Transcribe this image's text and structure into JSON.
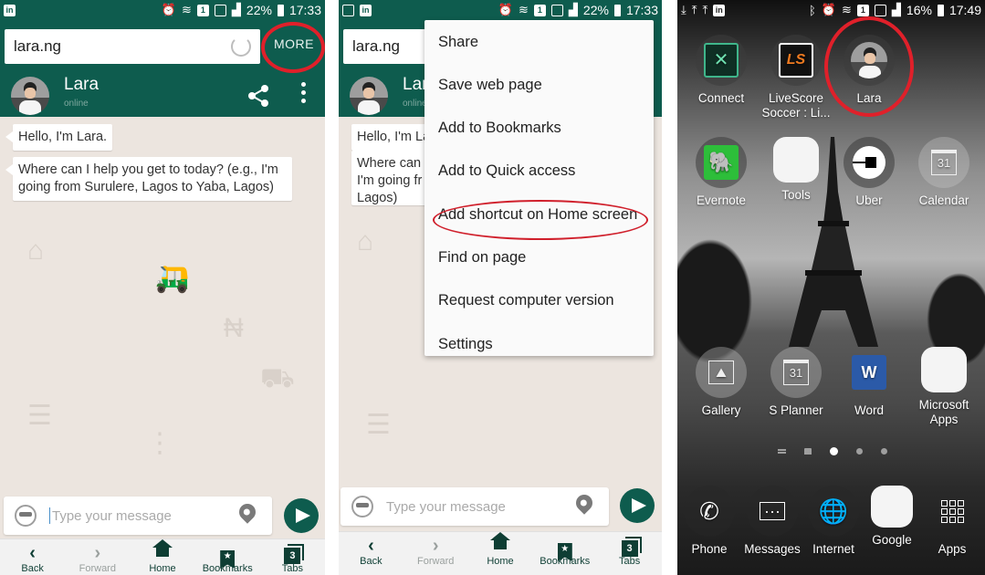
{
  "colors": {
    "brand_green": "#0e5c4e",
    "chat_background": "#ece5df",
    "annotation_red": "#d0202c"
  },
  "panel1": {
    "statusbar": {
      "left_icons": [
        "linkedin-icon"
      ],
      "right_icons": [
        "alarm-icon",
        "wifi-icon",
        "sim1-icon",
        "signal-icon",
        "signal-icon"
      ],
      "battery": "22%",
      "time": "17:33"
    },
    "url": "lara.ng",
    "more_label": "MORE",
    "contact": {
      "name": "Lara",
      "status": "online"
    },
    "messages": [
      {
        "text": "Hello, I'm Lara."
      },
      {
        "text": "Where can I help you get to today? (e.g., I'm going from Surulere, Lagos to Yaba, Lagos)"
      }
    ],
    "composer_placeholder": "Type your message",
    "nav": [
      {
        "label": "Back",
        "icon": "chevron-left-icon",
        "enabled": true
      },
      {
        "label": "Forward",
        "icon": "chevron-right-icon",
        "enabled": false
      },
      {
        "label": "Home",
        "icon": "home-icon",
        "enabled": true
      },
      {
        "label": "Bookmarks",
        "icon": "bookmark-star-icon",
        "enabled": true
      },
      {
        "label": "Tabs",
        "icon": "tabs-icon",
        "enabled": true,
        "count": "3"
      }
    ]
  },
  "panel2": {
    "statusbar": {
      "battery": "22%",
      "time": "17:33"
    },
    "url": "lara.ng",
    "contact": {
      "name": "Lara",
      "status": "online"
    },
    "messages_partial": [
      {
        "text": "Hello, I'm La"
      },
      {
        "text": "Where can I'm going fr Lagos)"
      }
    ],
    "menu": [
      {
        "label": "Share"
      },
      {
        "label": "Save web page"
      },
      {
        "label": "Add to Bookmarks"
      },
      {
        "label": "Add to Quick access"
      },
      {
        "label": "Add shortcut on Home screen",
        "highlighted": true
      },
      {
        "label": "Find on page"
      },
      {
        "label": "Request computer version"
      },
      {
        "label": "Settings"
      }
    ],
    "composer_placeholder": "Type your message",
    "nav": [
      {
        "label": "Back"
      },
      {
        "label": "Forward"
      },
      {
        "label": "Home"
      },
      {
        "label": "Bookmarks"
      },
      {
        "label": "Tabs",
        "count": "3"
      }
    ]
  },
  "panel3": {
    "statusbar": {
      "left_icons": [
        "download-icon",
        "upload-icon",
        "upload-icon",
        "linkedin-icon"
      ],
      "right_icons": [
        "bluetooth-icon",
        "alarm-icon",
        "wifi-icon",
        "sim1-icon",
        "signal-icon",
        "signal-icon"
      ],
      "battery": "16%",
      "time": "17:49"
    },
    "apps_row1": [
      {
        "label": "Connect",
        "icon": "connect-icon"
      },
      {
        "label": "LiveScore Soccer : Li...",
        "icon": "livescore-icon",
        "logo": "LS"
      },
      {
        "label": "Lara",
        "icon": "lara-avatar-icon",
        "highlighted": true
      }
    ],
    "apps_row2": [
      {
        "label": "Evernote",
        "icon": "evernote-icon"
      },
      {
        "label": "Tools",
        "icon": "tools-folder-icon"
      },
      {
        "label": "Uber",
        "icon": "uber-icon"
      },
      {
        "label": "Calendar",
        "icon": "calendar-icon",
        "day": "31"
      }
    ],
    "apps_row3": [
      {
        "label": "Gallery",
        "icon": "gallery-icon"
      },
      {
        "label": "S Planner",
        "icon": "s-planner-icon",
        "day": "31"
      },
      {
        "label": "Word",
        "icon": "word-icon",
        "logo": "W"
      },
      {
        "label": "Microsoft Apps",
        "icon": "microsoft-apps-folder-icon"
      }
    ],
    "page_indicator": {
      "pages": 5,
      "active_index": 2
    },
    "dock": [
      {
        "label": "Phone",
        "icon": "phone-icon"
      },
      {
        "label": "Messages",
        "icon": "messages-icon"
      },
      {
        "label": "Internet",
        "icon": "globe-icon"
      },
      {
        "label": "Google",
        "icon": "google-folder-icon"
      },
      {
        "label": "Apps",
        "icon": "apps-grid-icon"
      }
    ]
  }
}
